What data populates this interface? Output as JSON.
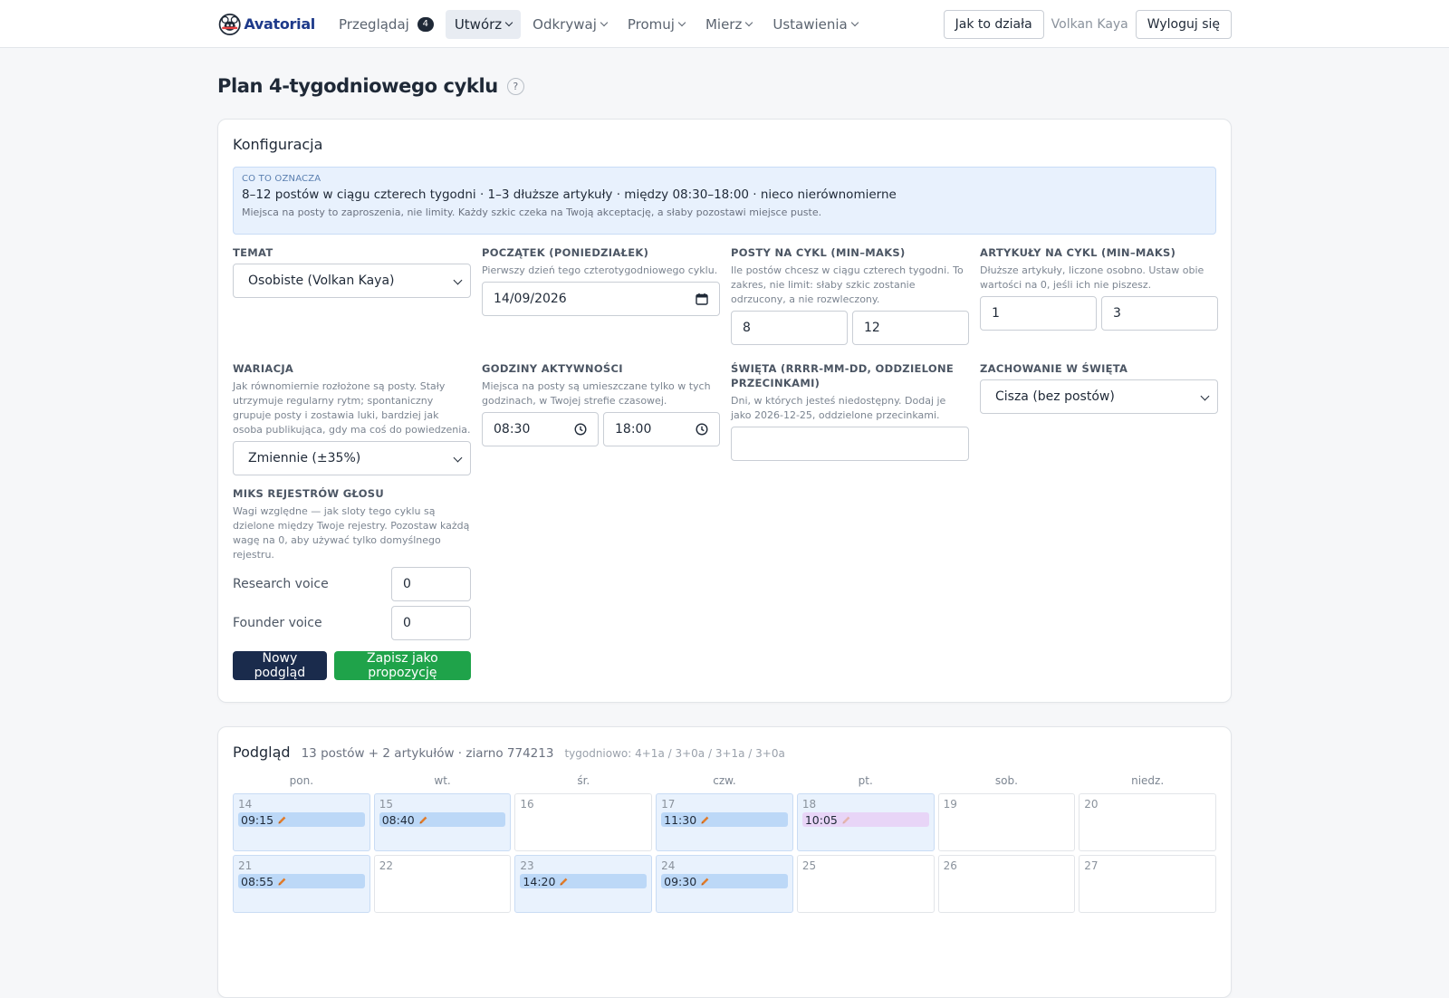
{
  "brand": {
    "name": "Avatorial"
  },
  "nav": {
    "items": [
      {
        "label": "Przeglądaj",
        "badge": "4",
        "active": false
      },
      {
        "label": "Utwórz",
        "active": true
      },
      {
        "label": "Odkrywaj",
        "active": false
      },
      {
        "label": "Promuj",
        "active": false
      },
      {
        "label": "Mierz",
        "active": false
      },
      {
        "label": "Ustawienia",
        "active": false
      }
    ],
    "how_it_works": "Jak to działa",
    "user": "Volkan Kaya",
    "logout": "Wyloguj się"
  },
  "page": {
    "title": "Plan 4‑tygodniowego cyklu",
    "help": "?"
  },
  "config": {
    "title": "Konfiguracja",
    "info": {
      "label": "CO TO OZNACZA",
      "main": "8–12 postów w ciągu czterech tygodni · 1–3 dłuższe artykuły · między 08:30–18:00 · nieco nierównomierne",
      "sub": "Miejsca na posty to zaproszenia, nie limity. Każdy szkic czeka na Twoją akceptację, a słaby pozostawi miejsce puste."
    },
    "topic": {
      "label": "TEMAT",
      "value": "Osobiste (Volkan Kaya)"
    },
    "start": {
      "label": "POCZĄTEK (PONIEDZIAŁEK)",
      "help": "Pierwszy dzień tego czterotygodniowego cyklu.",
      "value": "14/09/2026"
    },
    "posts": {
      "label": "POSTY NA CYKL (MIN–MAKS)",
      "help": "Ile postów chcesz w ciągu czterech tygodni. To zakres, nie limit: słaby szkic zostanie odrzucony, a nie rozwleczony.",
      "min": "8",
      "max": "12"
    },
    "articles": {
      "label": "ARTYKUŁY NA CYKL (MIN–MAKS)",
      "help": "Dłuższe artykuły, liczone osobno. Ustaw obie wartości na 0, jeśli ich nie piszesz.",
      "min": "1",
      "max": "3"
    },
    "variation": {
      "label": "WARIACJA",
      "help": "Jak równomiernie rozłożone są posty. Stały utrzymuje regularny rytm; spontaniczny grupuje posty i zostawia luki, bardziej jak osoba publikująca, gdy ma coś do powiedzenia.",
      "value": "Zmiennie (±35%)"
    },
    "hours": {
      "label": "GODZINY AKTYWNOŚCI",
      "help": "Miejsca na posty są umieszczane tylko w tych godzinach, w Twojej strefie czasowej.",
      "from": "08:30",
      "to": "18:00"
    },
    "holidays": {
      "label": "ŚWIĘTA (RRRR-MM-DD, ODDZIELONE PRZECINKAMI)",
      "help": "Dni, w których jesteś niedostępny. Dodaj je jako 2026-12-25, oddzielone przecinkami.",
      "value": ""
    },
    "holiday_behavior": {
      "label": "ZACHOWANIE W ŚWIĘTA",
      "value": "Cisza (bez postów)"
    },
    "voice_mix": {
      "label": "MIKS REJESTRÓW GŁOSU",
      "help": "Wagi względne — jak sloty tego cyklu są dzielone między Twoje rejestry. Pozostaw każdą wagę na 0, aby używać tylko domyślnego rejestru.",
      "items": [
        {
          "label": "Research voice",
          "value": "0"
        },
        {
          "label": "Founder voice",
          "value": "0"
        }
      ]
    },
    "buttons": {
      "preview": "Nowy podgląd",
      "save": "Zapisz jako propozycję"
    }
  },
  "preview": {
    "title": "Podgląd",
    "summary": "13 postów + 2 artykułów · ziarno 774213",
    "weekly": "tygodniowo: 4+1a / 3+0a / 3+1a / 3+0a",
    "weekdays": [
      "pon.",
      "wt.",
      "śr.",
      "czw.",
      "pt.",
      "sob.",
      "niedz."
    ],
    "days": [
      {
        "num": "14",
        "slot": "09:15",
        "kind": "post"
      },
      {
        "num": "15",
        "slot": "08:40",
        "kind": "post"
      },
      {
        "num": "16",
        "slot": "",
        "kind": ""
      },
      {
        "num": "17",
        "slot": "11:30",
        "kind": "post"
      },
      {
        "num": "18",
        "slot": "10:05",
        "kind": "article"
      },
      {
        "num": "19",
        "slot": "",
        "kind": ""
      },
      {
        "num": "20",
        "slot": "",
        "kind": ""
      },
      {
        "num": "21",
        "slot": "08:55",
        "kind": "post"
      },
      {
        "num": "22",
        "slot": "",
        "kind": ""
      },
      {
        "num": "23",
        "slot": "14:20",
        "kind": "post"
      },
      {
        "num": "24",
        "slot": "09:30",
        "kind": "post"
      },
      {
        "num": "25",
        "slot": "",
        "kind": ""
      },
      {
        "num": "26",
        "slot": "",
        "kind": ""
      },
      {
        "num": "27",
        "slot": "",
        "kind": ""
      }
    ]
  },
  "colors": {
    "primary": "#1a2b4c",
    "success": "#1fa34a",
    "info_bg": "#e8f1fd",
    "post_slot": "#bcd8f7",
    "article_slot": "#e8d5f7",
    "pencil": "#e07b2a"
  }
}
